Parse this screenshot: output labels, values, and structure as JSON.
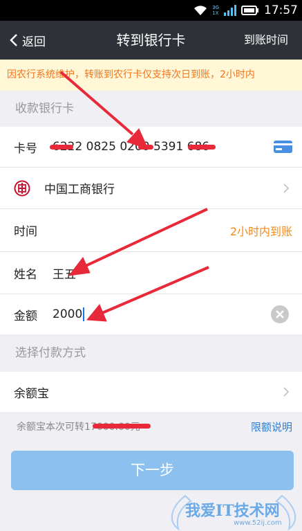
{
  "status_bar": {
    "network_top": "3G",
    "network_bottom": "1X",
    "time": "17:57"
  },
  "nav": {
    "back_label": "返回",
    "title": "转到银行卡",
    "right_label": "到账时间"
  },
  "notice": "因农行系统维护，转账到农行卡仅支持次日到账，2小时内",
  "sections": {
    "receiving_card_header": "收款银行卡",
    "payment_method_header": "选择付款方式"
  },
  "form": {
    "card_label": "卡号",
    "card_number": "6222 0825 0200 5391 686",
    "bank_name": "中国工商银行",
    "time_label": "时间",
    "time_value": "2小时内到账",
    "name_label": "姓名",
    "name_value": "王五",
    "amount_label": "金额",
    "amount_value": "2000"
  },
  "payment": {
    "method": "余额宝",
    "balance_hint": "余额宝本次可转17000.00元",
    "limit_link": "限额说明"
  },
  "next_button": "下一步",
  "watermark": {
    "text": "我爱IT技术网",
    "url": "www.52ij.com"
  },
  "colors": {
    "nav_bg": "#2e3138",
    "notice_text": "#f3741c",
    "notice_bg": "#fff7d6",
    "accent_orange": "#f08a1c",
    "link_blue": "#2a7ed6",
    "button_bg": "#8cc0ef",
    "annotation_red": "#e8293a"
  }
}
